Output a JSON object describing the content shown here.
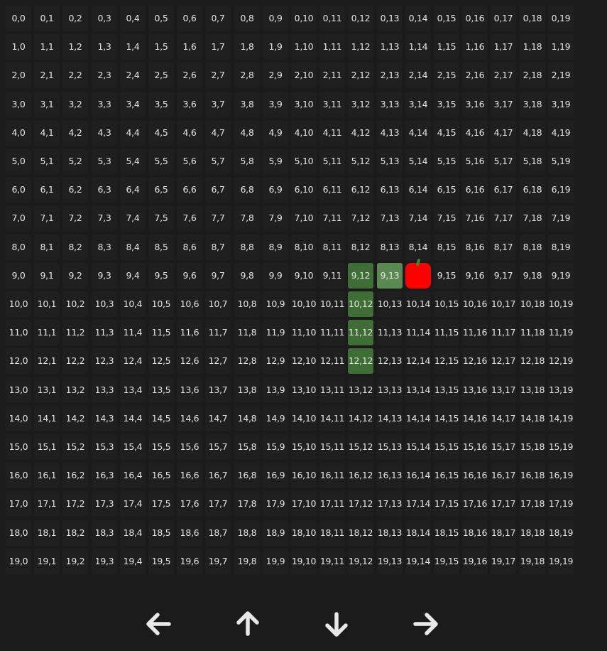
{
  "grid": {
    "rows": 20,
    "cols": 20,
    "snake": [
      [
        9,
        13
      ],
      [
        9,
        12
      ],
      [
        10,
        12
      ],
      [
        11,
        12
      ],
      [
        12,
        12
      ]
    ],
    "apple": [
      9,
      14
    ]
  },
  "colors": {
    "background": "#1b1b1b",
    "cell": "#1f1f1f",
    "cell_text": "#e4e4e4",
    "snake_head": "#5a8a52",
    "snake_body": "#3f6d36",
    "apple": "#ff0000",
    "apple_stem": "#3a8a28",
    "arrow": "#e8e8e8"
  },
  "controls": [
    {
      "icon": "arrow-left-icon",
      "direction": "left"
    },
    {
      "icon": "arrow-up-icon",
      "direction": "up"
    },
    {
      "icon": "arrow-down-icon",
      "direction": "down"
    },
    {
      "icon": "arrow-right-icon",
      "direction": "right"
    }
  ]
}
